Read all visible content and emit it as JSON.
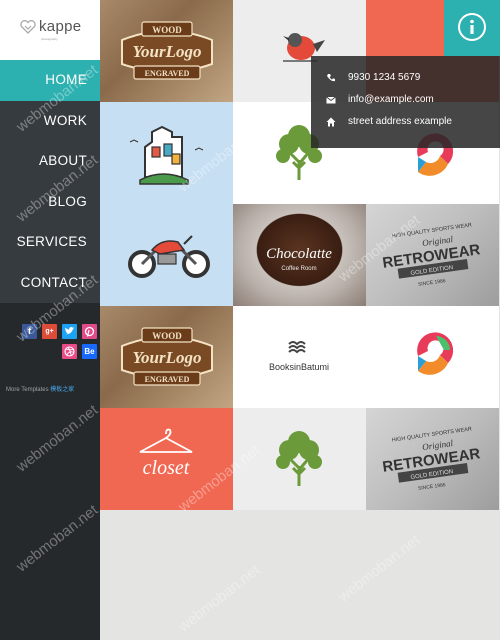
{
  "brand": {
    "name": "kappe",
    "tagline": "photography"
  },
  "nav": [
    {
      "label": "HOME"
    },
    {
      "label": "WORK"
    },
    {
      "label": "ABOUT"
    },
    {
      "label": "BLOG"
    },
    {
      "label": "SERVICES"
    },
    {
      "label": "CONTACT"
    }
  ],
  "social": [
    "facebook-icon",
    "google-plus-icon",
    "twitter-icon",
    "pinterest-icon",
    "dribbble-icon",
    "behance-icon"
  ],
  "footer": {
    "prefix": "More Templates",
    "link": "模板之家"
  },
  "contact": {
    "phone": "9930 1234 5679",
    "email": "info@example.com",
    "address": "street address example"
  },
  "tiles": {
    "wood_top": "WOOD",
    "wood_main": "YourLogo",
    "wood_bottom": "ENGRAVED",
    "coffee_main": "Chocolatte",
    "coffee_sub": "Coffee Room",
    "retro_top": "HIGH QUALITY SPORTS WEAR",
    "retro_script": "Original",
    "retro_main": "RETROWEAR",
    "retro_sub": "GOLD EDITION",
    "retro_year": "SINCE 1986",
    "books_main": "BooksinBatumi",
    "closet": "closet"
  },
  "watermark": "webmoban.net",
  "colors": {
    "teal": "#2db0b0",
    "coral": "#f16852",
    "sidebar": "#25292c"
  }
}
